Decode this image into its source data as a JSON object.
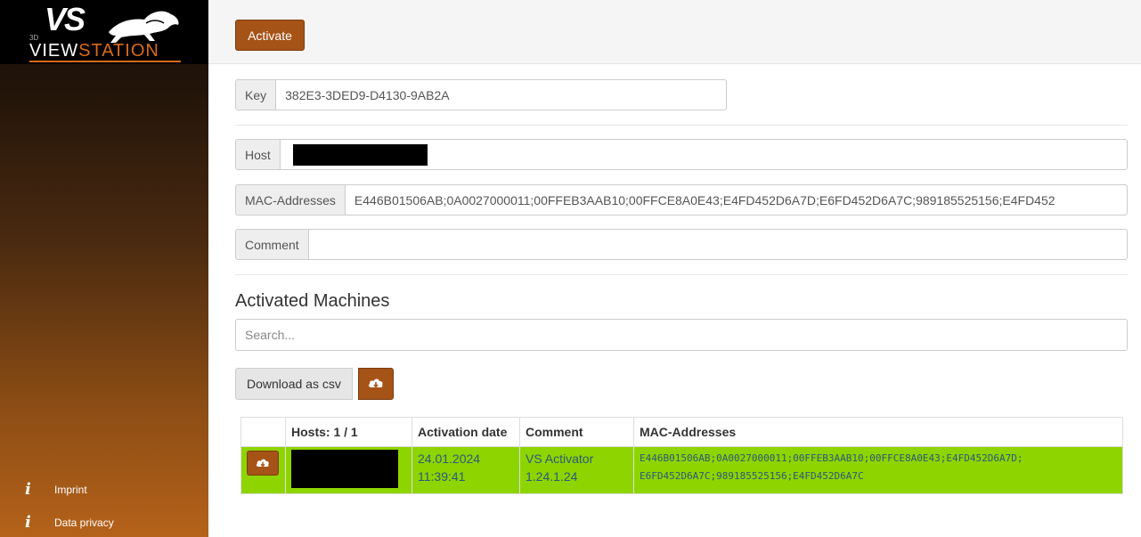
{
  "brand": {
    "logo_vs": "VS",
    "logo_3d": "3D",
    "logo_word_a": "VIEW",
    "logo_word_b": "STATION"
  },
  "sidebar": {
    "links": [
      {
        "label": "Imprint",
        "icon": "info-icon"
      },
      {
        "label": "Data privacy",
        "icon": "info-icon"
      }
    ]
  },
  "toolbar": {
    "activate_label": "Activate"
  },
  "form": {
    "key_label": "Key",
    "key_value": "382E3-3DED9-D4130-9AB2A",
    "host_label": "Host",
    "mac_label": "MAC-Addresses",
    "mac_value": "E446B01506AB;0A0027000011;00FFEB3AAB10;00FFCE8A0E43;E4FD452D6A7D;E6FD452D6A7C;989185525156;E4FD452",
    "comment_label": "Comment",
    "comment_value": ""
  },
  "machines": {
    "title": "Activated Machines",
    "search_placeholder": "Search...",
    "download_label": "Download as csv",
    "columns": [
      "",
      "Hosts: 1 / 1",
      "Activation date",
      "Comment",
      "MAC-Addresses"
    ],
    "rows": [
      {
        "date": "24.01.2024",
        "time": "11:39:41",
        "comment_line1": "VS Activator",
        "comment_line2": "1.24.1.24",
        "mac_line1": "E446B01506AB;0A0027000011;00FFEB3AAB10;00FFCE8A0E43;E4FD452D6A7D;",
        "mac_line2": "E6FD452D6A7C;989185525156;E4FD452D6A7C"
      }
    ]
  },
  "colors": {
    "accent": "#a65317",
    "row_highlight": "#8ed400",
    "sidebar_top": "#140c05",
    "sidebar_bottom": "#b5621a"
  }
}
